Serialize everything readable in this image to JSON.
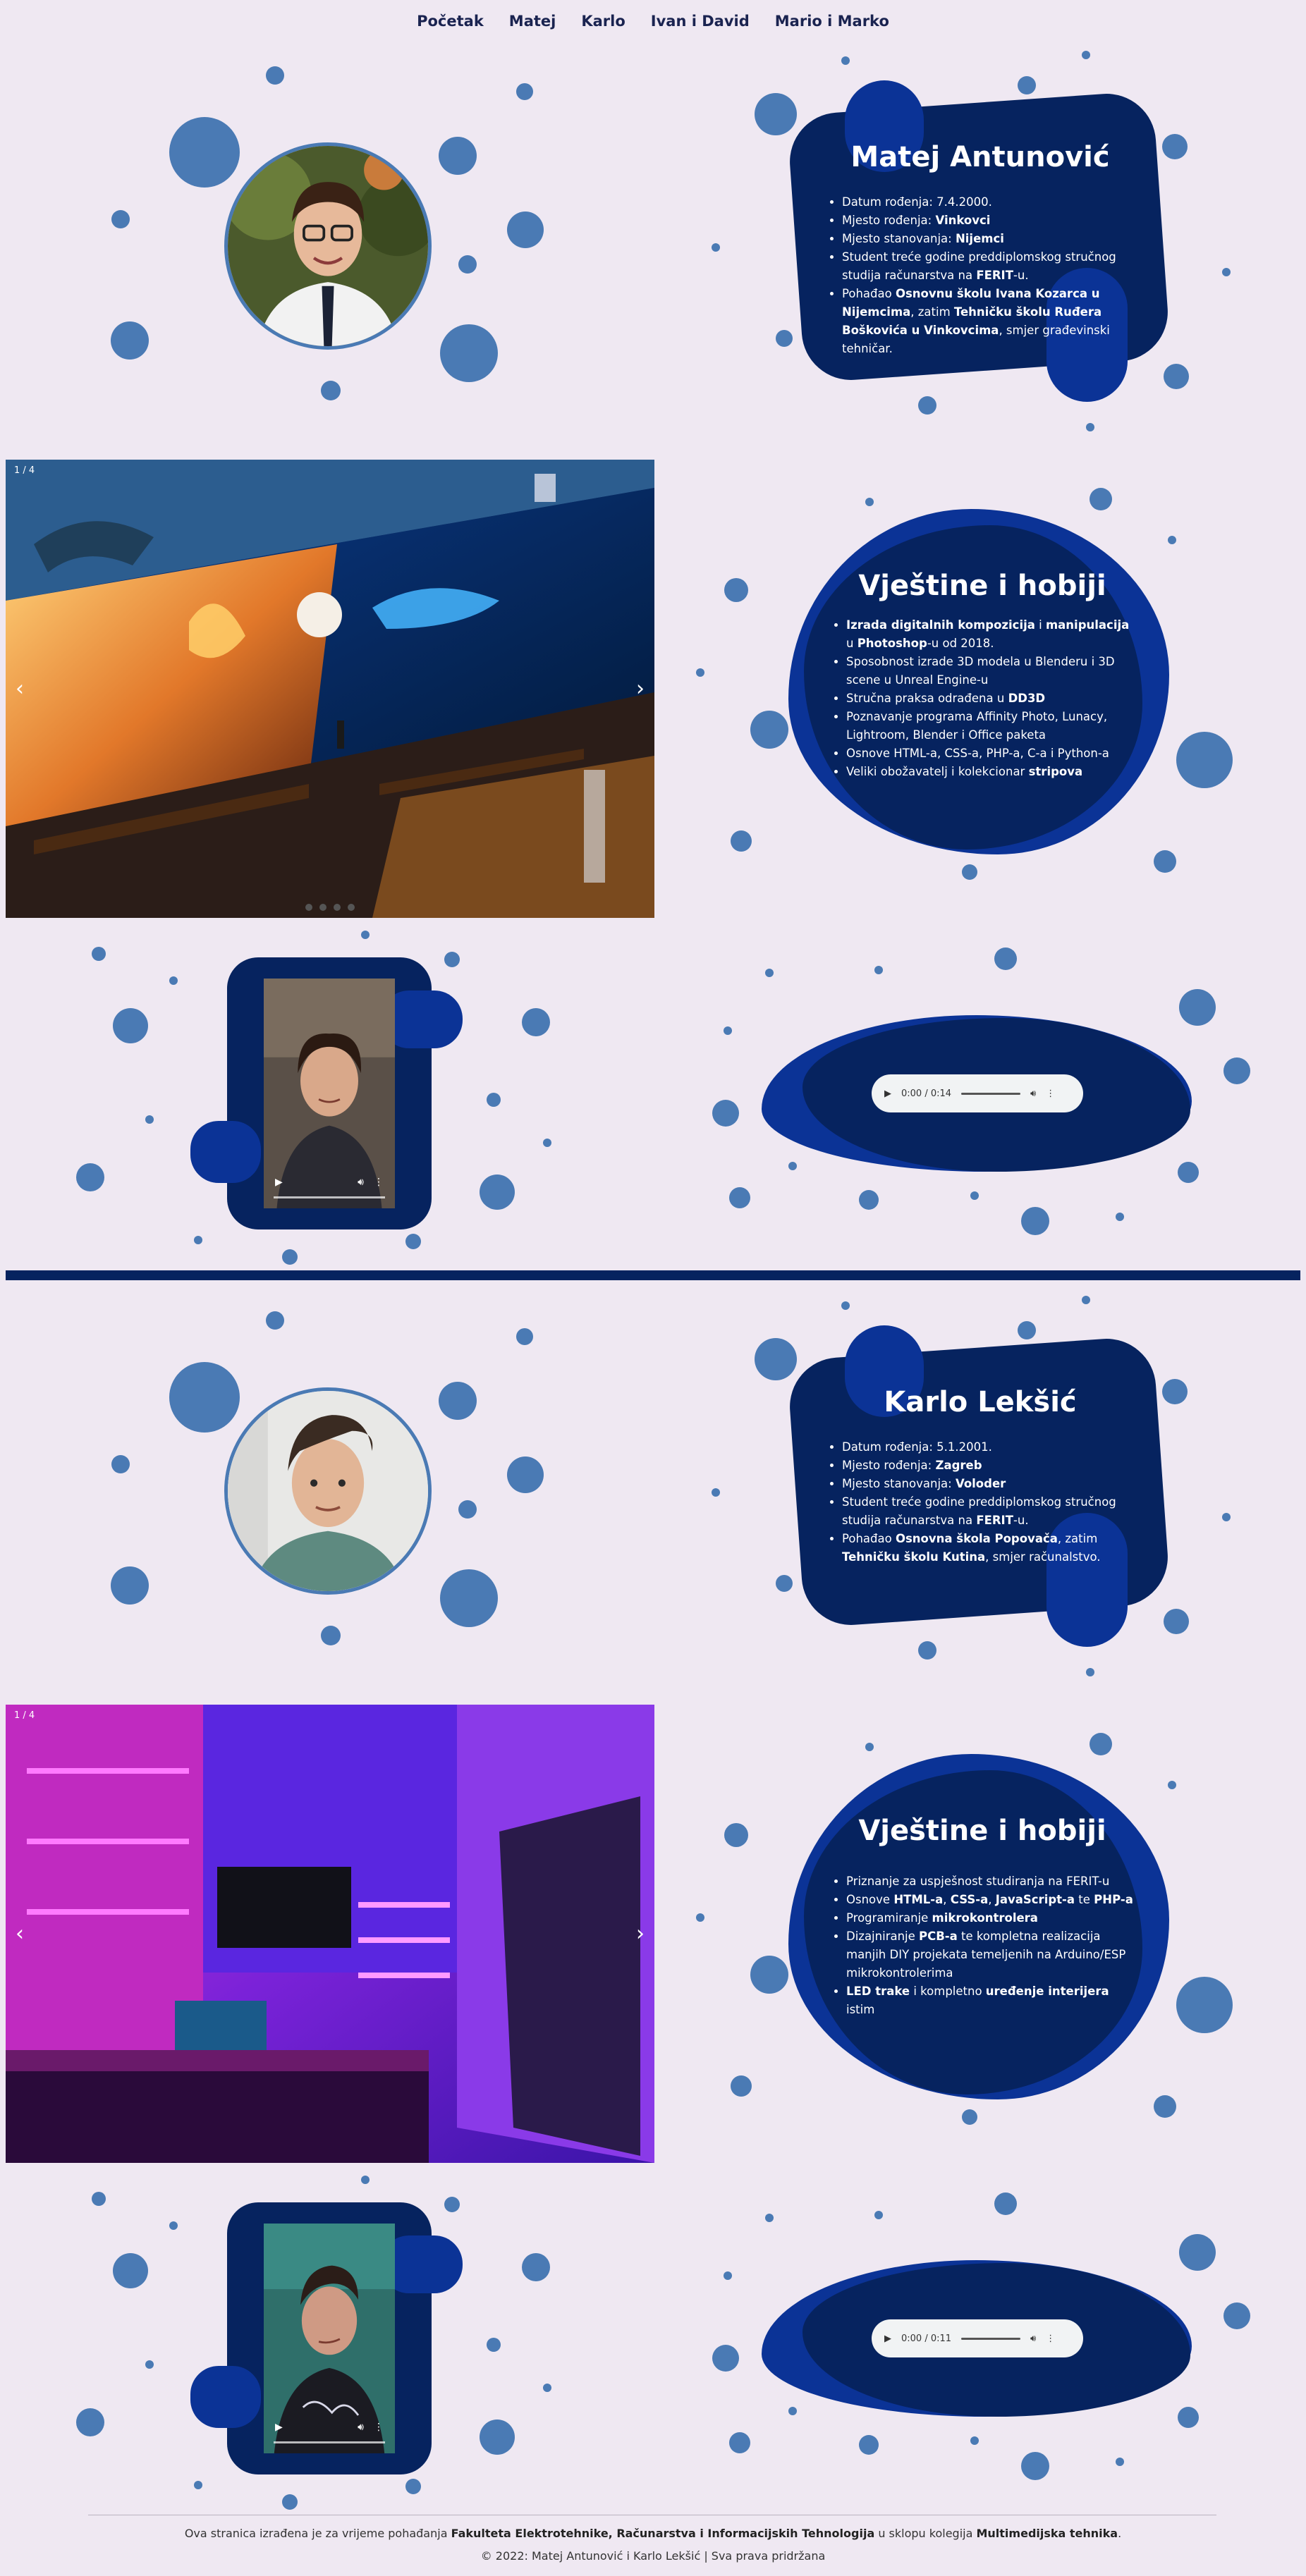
{
  "nav": {
    "items": [
      "Početak",
      "Matej",
      "Karlo",
      "Ivan i David",
      "Mario i Marko"
    ]
  },
  "people": [
    {
      "name": "Matej Antunović",
      "info": [
        {
          "pre": "Datum rođenja: 7.4.2000.",
          "b": "",
          "post": ""
        },
        {
          "pre": "Mjesto rođenja: ",
          "b": "Vinkovci",
          "post": ""
        },
        {
          "pre": "Mjesto stanovanja: ",
          "b": "Nijemci",
          "post": ""
        },
        {
          "pre": "Student treće godine preddiplomskog stručnog studija računarstva na ",
          "b": "FERIT",
          "post": "-u."
        },
        {
          "pre": "Pohađao ",
          "b": "Osnovnu školu Ivana Kozarca u Nijemcima",
          "post": ", zatim ",
          "b2": "Tehničku školu Ruđera Boškovića u Vinkovcima",
          "post2": ", smjer građevinski tehničar."
        }
      ],
      "slider_counter": "1 / 4",
      "skills_title": "Vještine i hobiji",
      "skills": [
        {
          "b": "Izrada digitalnih kompozicija",
          "m": " i ",
          "b2": "manipulacija",
          "post": " u ",
          "b3": "Photoshop",
          "post2": "-u od 2018."
        },
        {
          "pre": "Sposobnost izrade 3D modela u Blenderu i 3D scene u Unreal Engine-u"
        },
        {
          "pre": "Stručna praksa odrađena u ",
          "b": "DD3D"
        },
        {
          "pre": "Poznavanje programa Affinity Photo, Lunacy, Lightroom, Blender i Office paketa"
        },
        {
          "pre": "Osnove HTML-a, CSS-a, PHP-a, C-a i Python-a"
        },
        {
          "pre": "Veliki obožavatelj i kolekcionar ",
          "b": "stripova"
        }
      ],
      "audio_time": "0:00 / 0:14"
    },
    {
      "name": "Karlo Lekšić",
      "info": [
        {
          "pre": "Datum rođenja: 5.1.2001.",
          "b": "",
          "post": ""
        },
        {
          "pre": "Mjesto rođenja: ",
          "b": "Zagreb",
          "post": ""
        },
        {
          "pre": "Mjesto stanovanja: ",
          "b": "Voloder",
          "post": ""
        },
        {
          "pre": "Student treće godine preddiplomskog stručnog studija računarstva na ",
          "b": "FERIT",
          "post": "-u."
        },
        {
          "pre": "Pohađao ",
          "b": "Osnovna škola Popovača",
          "post": ", zatim ",
          "b2": "Tehničku školu Kutina",
          "post2": ", smjer računalstvo."
        }
      ],
      "slider_counter": "1 / 4",
      "skills_title": "Vještine i hobiji",
      "skills": [
        {
          "pre": "Priznanje za uspješnost studiranja na FERIT-u"
        },
        {
          "pre": "Osnove ",
          "b": "HTML-a",
          "m": ", ",
          "b2": "CSS-a",
          "m2": ", ",
          "b3": "JavaScript-a",
          "m3": " te ",
          "b4": "PHP-a"
        },
        {
          "pre": "Programiranje ",
          "b": "mikrokontrolera"
        },
        {
          "pre": "Dizajniranje ",
          "b": "PCB-a",
          "post": " te kompletna realizacija manjih DIY projekata temeljenih na Arduino/ESP mikrokontrolerima"
        },
        {
          "b": "LED trake",
          "m": " i kompletno ",
          "b2": "uređenje interijera",
          "post": " istim"
        }
      ],
      "audio_time": "0:00 / 0:11"
    }
  ],
  "icons": {
    "prev": "chevron-left-icon",
    "next": "chevron-right-icon",
    "play": "play-icon",
    "volume": "volume-icon",
    "more": "more-vert-icon"
  },
  "footer": {
    "line1_pre": "Ova stranica izrađena je za vrijeme pohađanja ",
    "line1_b": "Fakulteta Elektrotehnike, Računarstva i Informacijskih Tehnologija",
    "line1_mid": " u sklopu kolegija ",
    "line1_b2": "Multimedijska tehnika",
    "line1_end": ".",
    "line2": "© 2022: Matej Antunović i Karlo Lekšić | Sva prava pridržana"
  },
  "colors": {
    "background": "#efe8f2",
    "navy": "#06235f",
    "blue": "#0b3396",
    "dot": "#4a7ab4"
  }
}
